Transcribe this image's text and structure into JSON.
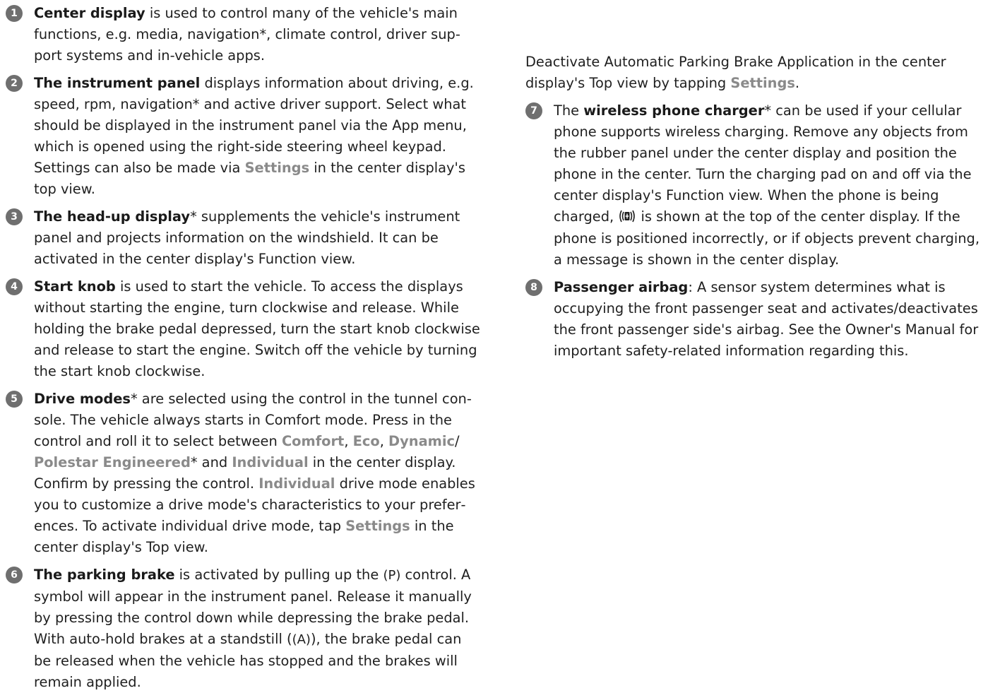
{
  "items": {
    "i1": {
      "num": "1",
      "title": "Center display",
      "body": " is used to control many of the vehicle's main functions, e.g. media, navigation*, climate control, driver sup­port systems and in-vehicle apps."
    },
    "i2": {
      "num": "2",
      "title": "The instrument panel",
      "body1": " displays information about driving, e.g. speed, rpm, navigation* and active driver support. Select what should be displayed in the instrument panel via the App menu, which is opened using the right-side steering wheel keypad. Settings can also be made via ",
      "settings": "Settings",
      "body2": " in the center display's top view."
    },
    "i3": {
      "num": "3",
      "title": "The head-up display",
      "body": "* supplements the vehicle's instrument panel and projects information on the windshield. It can be activated in the center display's Function view."
    },
    "i4": {
      "num": "4",
      "title": "Start knob",
      "body": " is used to start the vehicle. To access the displays without starting the engine, turn clockwise and release. While holding the brake pedal depressed, turn the start knob clock­wise and release to start the engine. Switch off the vehicle by turning the start knob clockwise."
    },
    "i5": {
      "num": "5",
      "title": "Drive modes",
      "t1": "* are selected using the control in the tunnel con­sole. The vehicle always starts in Comfort mode. Press in the control and roll it to select between ",
      "comfort": "Comfort",
      "sep1": ", ",
      "eco": "Eco",
      "sep2": ", ",
      "dynamic": "Dynamic",
      "slash": "/ ",
      "polestar": "Polestar Engineered",
      "t2": "* and ",
      "individual": "Individual",
      "t3": " in the center display. Con­firm by pressing the control. ",
      "individual2": "Individual",
      "t4": " drive mode enables you to customize a drive mode's characteristics to your prefer­ences. To activate individual drive mode, tap ",
      "settings": "Settings",
      "t5": " in the cen­ter display's Top view."
    },
    "i6": {
      "num": "6",
      "title": "The parking brake",
      "t1": " is activated by pulling up the ",
      "p_symbol": "(P)",
      "t2": " control. A symbol will appear in the instrument panel. Release it manually by pressing the control down while depressing the brake pedal. With auto-hold brakes at a standstill (",
      "a_symbol": "(A)",
      "t3": "), the brake pedal can be released when the vehicle has stopped and the brakes will remain applied.",
      "p2a": "Deactivate Automatic Parking Brake Application in the center display's Top view by tapping ",
      "settings": "Settings",
      "p2b": "."
    },
    "i7": {
      "num": "7",
      "pre": "The ",
      "title": "wireless phone charger",
      "t1": "* can be used if your cellular phone supports wireless charging. Remove any objects from the rubber panel under the center display and position the phone in the center. Turn the charging pad on and off via the center display's Function view. When the phone is being charged, ",
      "t2": " is shown at the top of the center display. If the phone is positioned incorrectly, or if objects prevent charging, a message is shown in the center display."
    },
    "i8": {
      "num": "8",
      "title": "Passenger airbag",
      "body": ": A sensor system determines what is occu­pying the front passenger seat and activates/deactivates the front passenger side's airbag. See the Owner's Manual for important safety-related information regarding this."
    }
  }
}
